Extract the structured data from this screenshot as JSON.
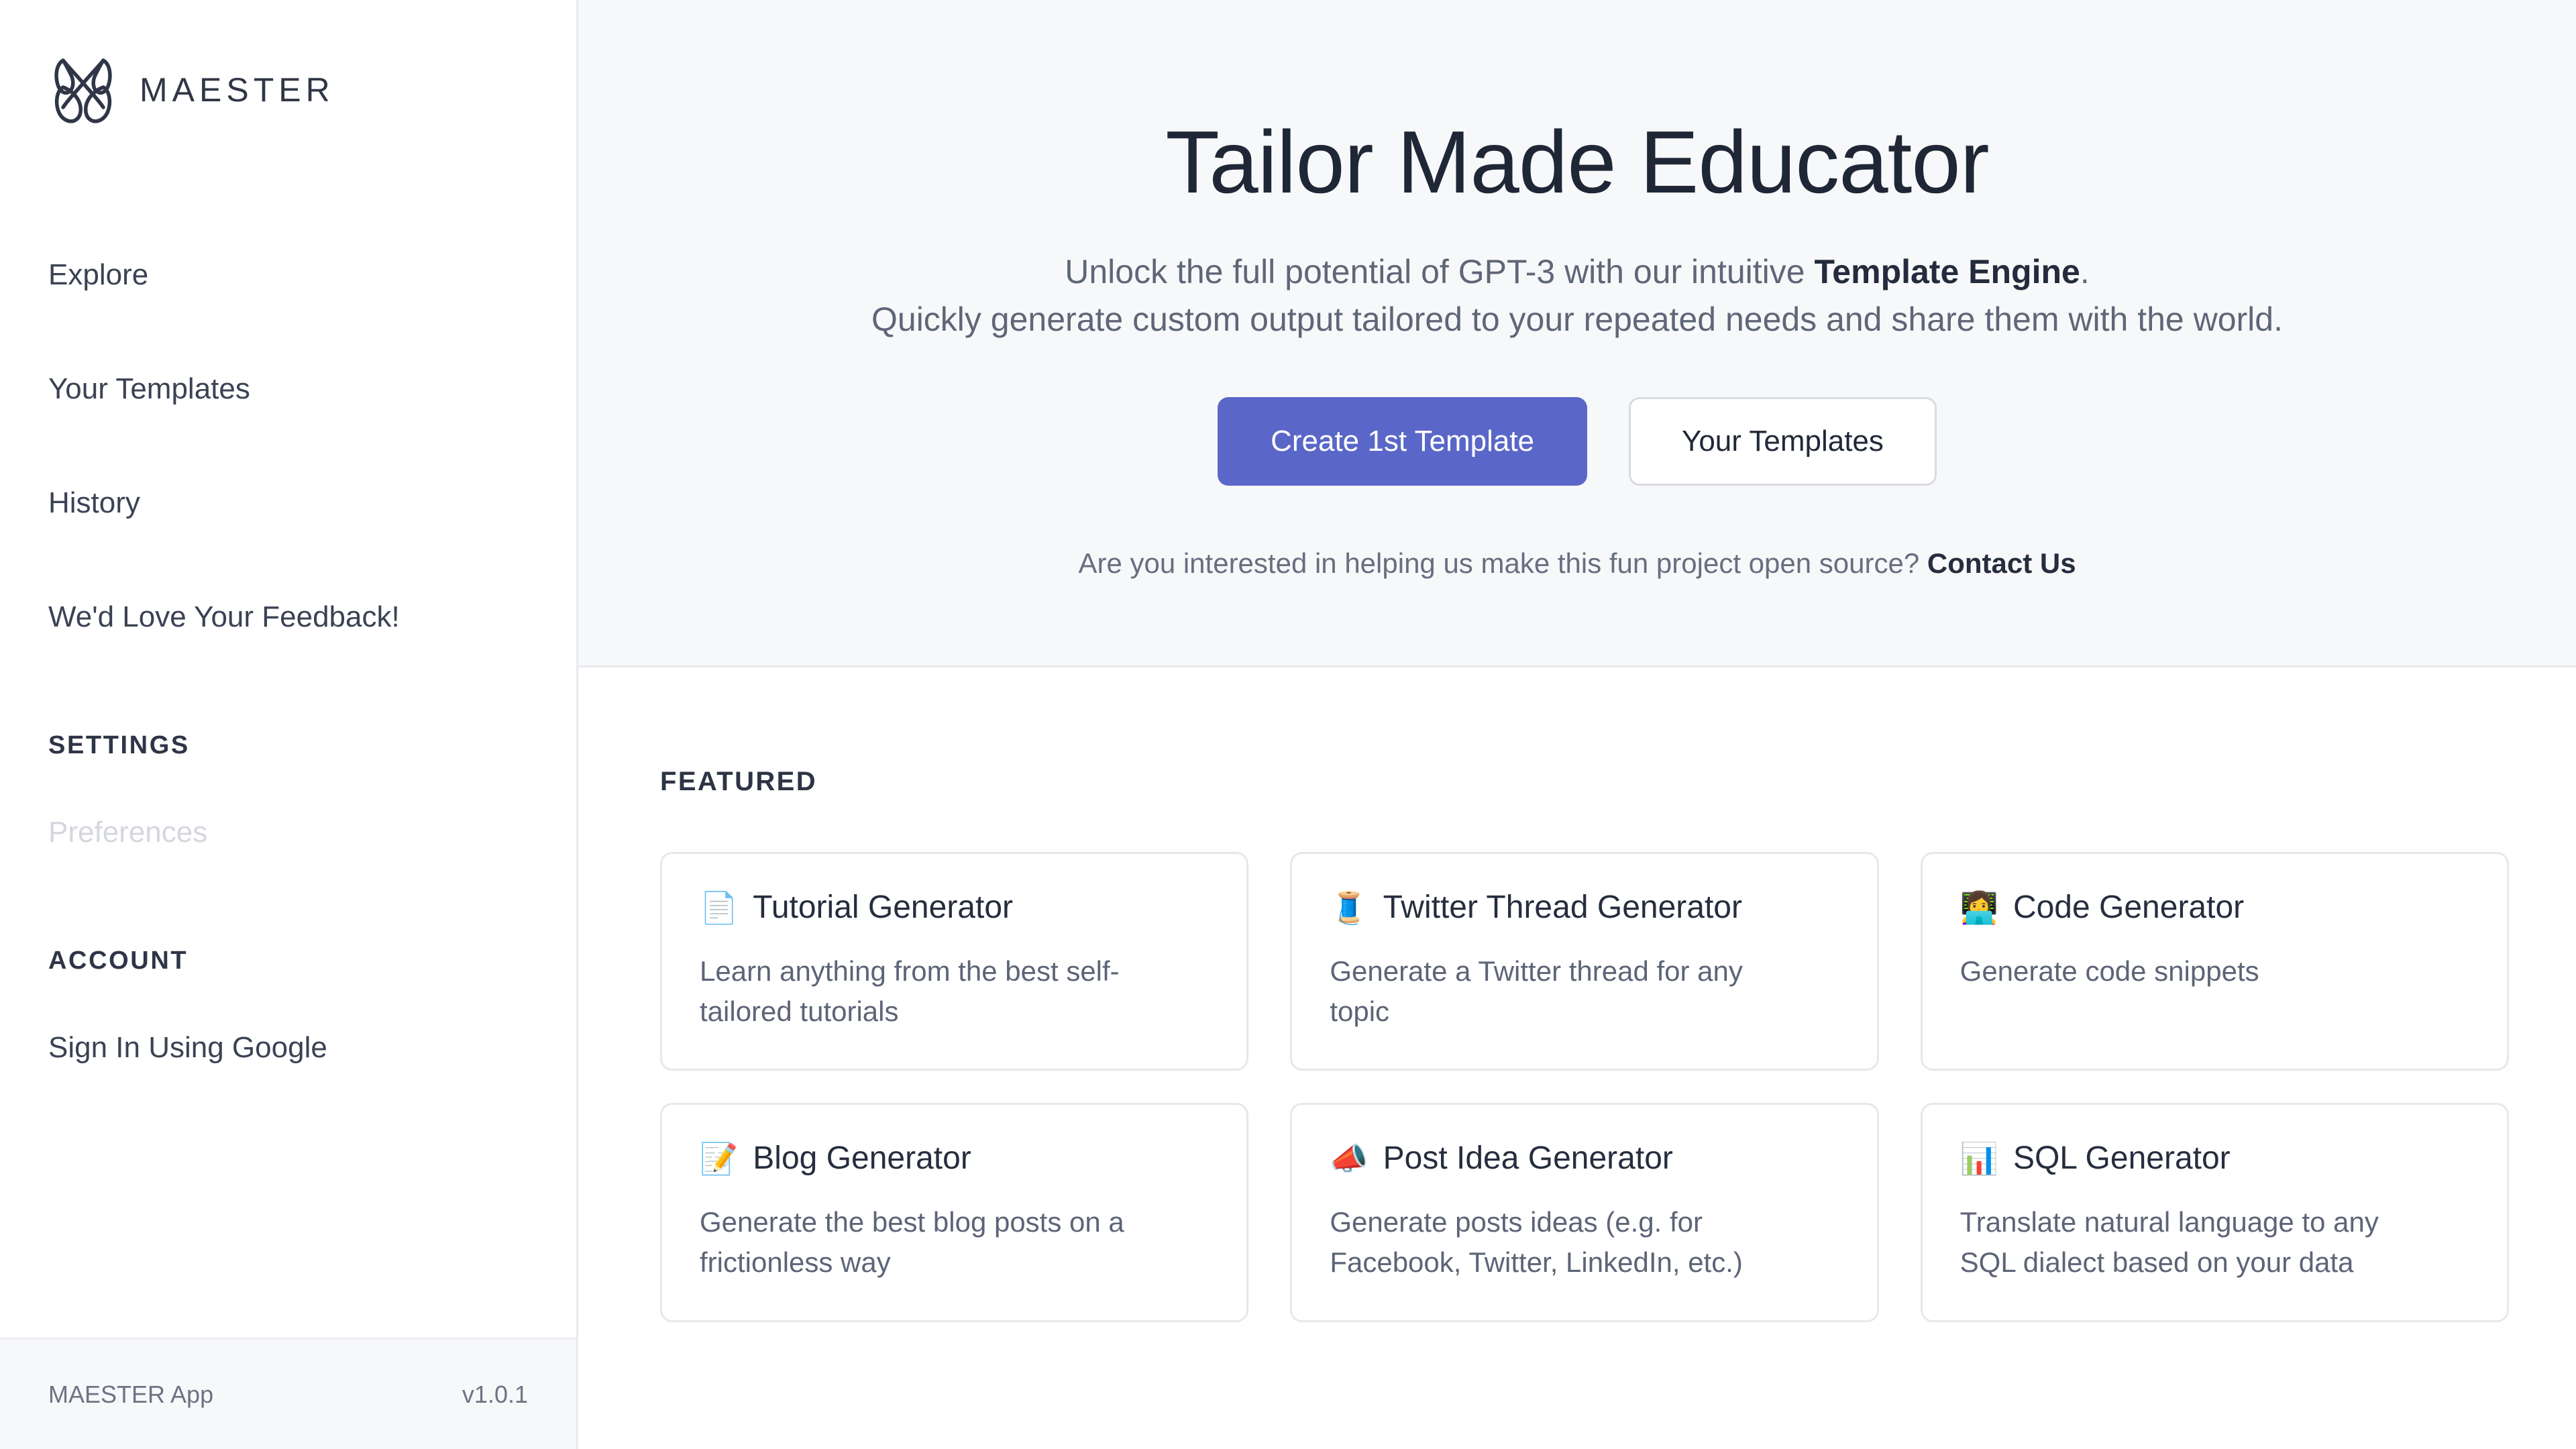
{
  "brand": {
    "name": "MAESTER",
    "logo_icon": "maester-knot-logo-icon"
  },
  "sidebar": {
    "nav": [
      {
        "label": "Explore"
      },
      {
        "label": "Your Templates"
      },
      {
        "label": "History"
      },
      {
        "label": "We'd Love Your Feedback!"
      }
    ],
    "settings": {
      "label": "SETTINGS",
      "items": [
        {
          "label": "Preferences",
          "disabled": true
        }
      ]
    },
    "account": {
      "label": "ACCOUNT",
      "items": [
        {
          "label": "Sign In Using Google",
          "disabled": false
        }
      ]
    },
    "footer": {
      "app_name": "MAESTER App",
      "version": "v1.0.1"
    }
  },
  "hero": {
    "title": "Tailor Made Educator",
    "subtitle_line1_prefix": "Unlock the full potential of GPT-3 with our intuitive ",
    "subtitle_line1_bold": "Template Engine",
    "subtitle_line1_suffix": ".",
    "subtitle_line2": "Quickly generate custom output tailored to your repeated needs and share them with the world.",
    "primary_button": "Create 1st Template",
    "secondary_button": "Your Templates",
    "note_text": "Are you interested in helping us make this fun project open source?",
    "note_link": "Contact Us"
  },
  "featured": {
    "label": "FEATURED",
    "cards": [
      {
        "emoji": "📄",
        "icon_name": "page-facing-up-icon",
        "title": "Tutorial Generator",
        "description": "Learn anything from the best self-tailored tutorials"
      },
      {
        "emoji": "🧵",
        "icon_name": "thread-spool-icon",
        "title": "Twitter Thread Generator",
        "description": "Generate a Twitter thread for any topic"
      },
      {
        "emoji": "👩‍💻",
        "icon_name": "technologist-icon",
        "title": "Code Generator",
        "description": "Generate code snippets"
      },
      {
        "emoji": "📝",
        "icon_name": "memo-icon",
        "title": "Blog Generator",
        "description": "Generate the best blog posts on a frictionless way"
      },
      {
        "emoji": "📣",
        "icon_name": "megaphone-icon",
        "title": "Post Idea Generator",
        "description": "Generate posts ideas (e.g. for Facebook, Twitter, LinkedIn, etc.)"
      },
      {
        "emoji": "📊",
        "icon_name": "bar-chart-icon",
        "title": "SQL Generator",
        "description": "Translate natural language to any SQL dialect based on your data"
      }
    ]
  },
  "colors": {
    "accent": "#5a67c8",
    "text_dark": "#1f2737",
    "text_muted": "#5f6678",
    "hero_bg": "#f7f8f9",
    "border": "#e6e8ec"
  }
}
